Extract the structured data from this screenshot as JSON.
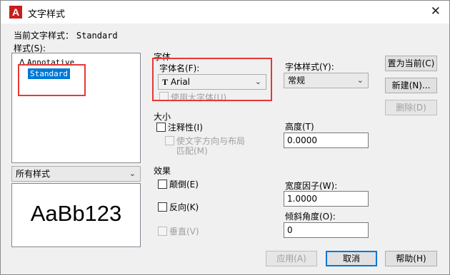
{
  "window": {
    "title": "文字样式",
    "app_icon": "A"
  },
  "current_style": {
    "label": "当前文字样式：",
    "value": "Standard"
  },
  "styles_list": {
    "label": "样式(S):",
    "items": [
      {
        "icon": "annotative-icon",
        "label": "Annotative"
      },
      {
        "label": "Standard",
        "selected": true
      }
    ]
  },
  "filter": {
    "value": "所有样式"
  },
  "preview": {
    "text": "AaBb123"
  },
  "font": {
    "group_label": "字体",
    "font_name_label": "字体名(F):",
    "font_name_value": "Arial",
    "font_icon": "truetype-icon",
    "font_style_label": "字体样式(Y):",
    "font_style_value": "常规",
    "bigfont_label": "使用大字体(U)"
  },
  "size": {
    "group_label": "大小",
    "annotative_label": "注释性(I)",
    "match_orientation_label_1": "使文字方向与布局",
    "match_orientation_label_2": "匹配(M)",
    "height_label": "高度(T)",
    "height_value": "0.0000"
  },
  "effects": {
    "group_label": "效果",
    "upside_down_label": "颠倒(E)",
    "backwards_label": "反向(K)",
    "vertical_label": "垂直(V)",
    "width_factor_label": "宽度因子(W):",
    "width_factor_value": "1.0000",
    "oblique_label": "倾斜角度(O):",
    "oblique_value": "0"
  },
  "buttons": {
    "set_current": "置为当前(C)",
    "new": "新建(N)...",
    "delete": "删除(D)",
    "apply": "应用(A)",
    "cancel": "取消",
    "help": "帮助(H)"
  },
  "colors": {
    "selection": "#0078d7",
    "highlight_box": "#e53935"
  }
}
